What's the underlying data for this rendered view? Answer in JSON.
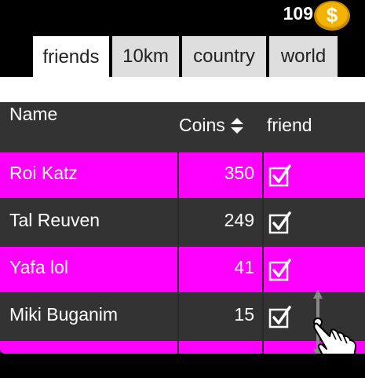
{
  "header": {
    "coin_count": "109",
    "coin_icon": "dollar-coin-icon"
  },
  "tabs": [
    {
      "label": "friends",
      "active": true
    },
    {
      "label": "10km",
      "active": false
    },
    {
      "label": "country",
      "active": false
    },
    {
      "label": "world",
      "active": false
    }
  ],
  "table": {
    "columns": {
      "name": "Name",
      "coins": "Coins",
      "friend": "friend"
    },
    "rows": [
      {
        "name": "Roi Katz",
        "coins": "350",
        "friend": true
      },
      {
        "name": "Tal Reuven",
        "coins": "249",
        "friend": true
      },
      {
        "name": "Yafa lol",
        "coins": "41",
        "friend": true
      },
      {
        "name": "Miki Buganim",
        "coins": "15",
        "friend": true
      }
    ]
  },
  "colors": {
    "row_highlight": "#ff00ff",
    "row_dark": "#333333",
    "coin_gold": "#f2b400"
  },
  "icons": {
    "sort": "sort-updown-icon",
    "check": "checkbox-checked-icon",
    "scroll_hand": "pointing-hand-icon"
  }
}
